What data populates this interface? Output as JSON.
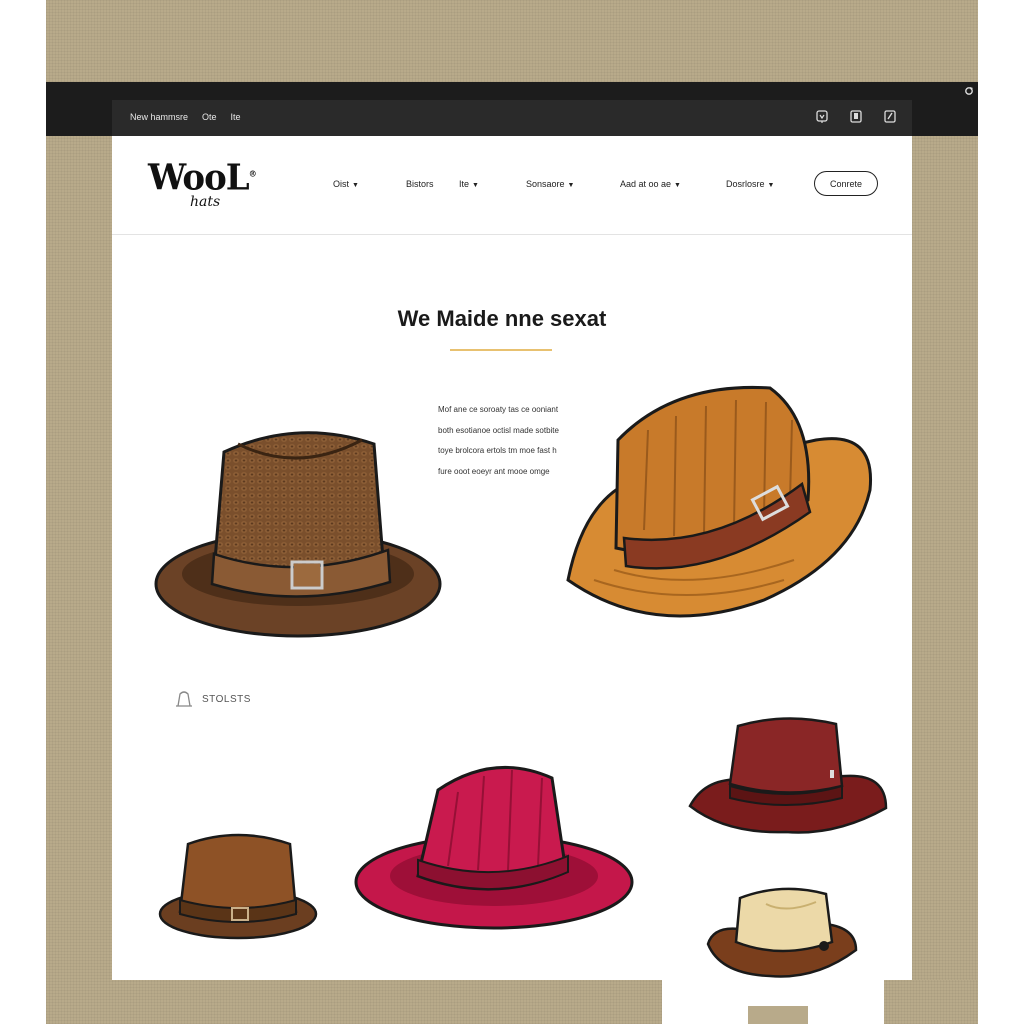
{
  "topbar": {
    "links": [
      "New hammsre",
      "Ote",
      "Ite"
    ],
    "icons": [
      "cart-icon",
      "bookmark-icon",
      "edit-icon"
    ]
  },
  "logo": {
    "main": "WooL",
    "sub": "hats"
  },
  "nav": {
    "items": [
      "Oist",
      "Bistors",
      "Ite",
      "Sonsaore",
      "Aad at oo ae",
      "Dosrlosre"
    ],
    "contact": "Conrete"
  },
  "hero": {
    "headline": "We Maide nne sexat",
    "blurb": [
      "Mof ane ce soroaty tas ce ooniant",
      "both esotianoe octisl made sotbite",
      "toye brolcora ertols tm moe fast h",
      "fure ooot eoeyr ant mooe omge"
    ]
  },
  "section": {
    "label": "STOLSTS"
  },
  "colors": {
    "accent": "#e8c170",
    "topbar": "#1c1c1c",
    "backdrop": "#b8aa8a"
  }
}
